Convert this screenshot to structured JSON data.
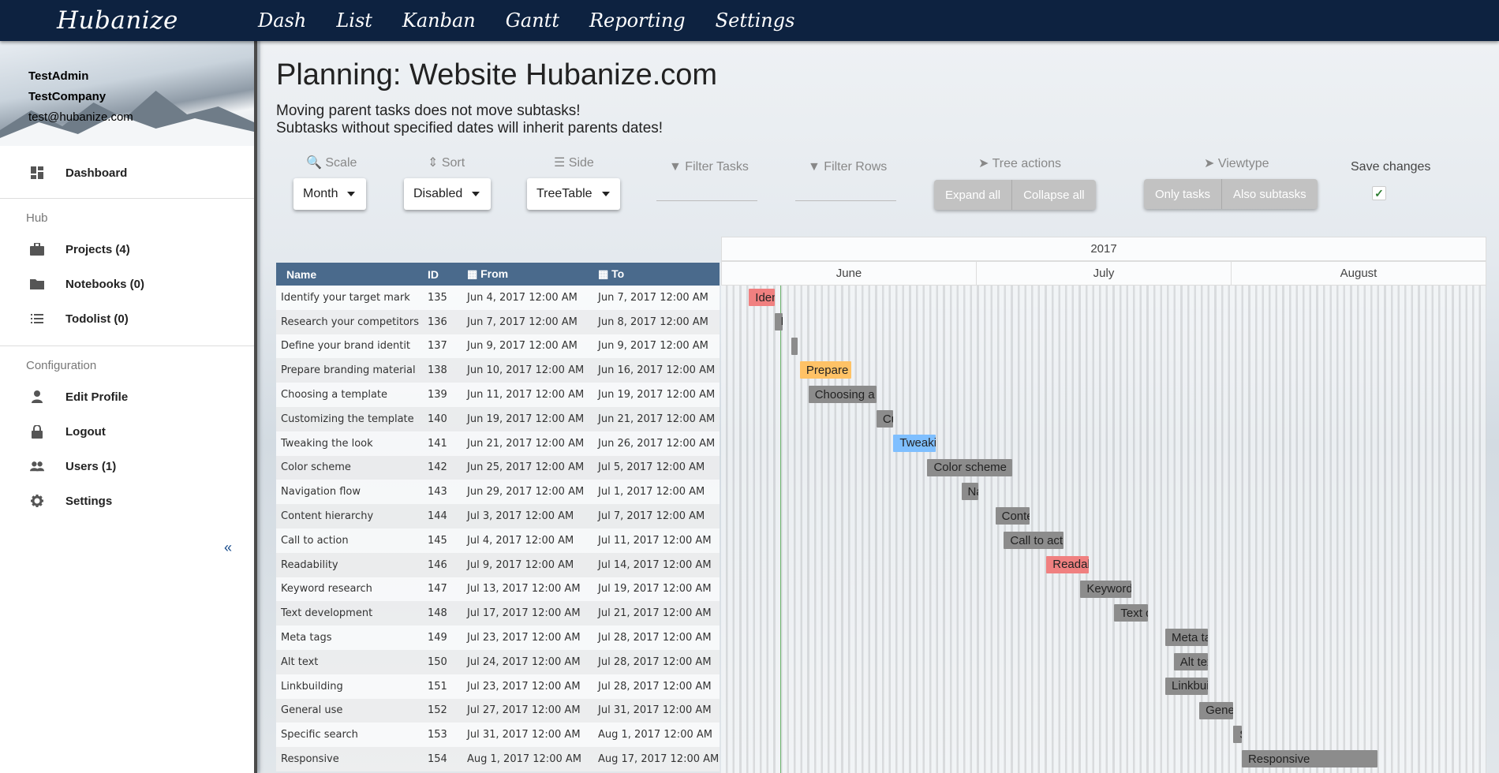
{
  "nav": {
    "brand": "Hubanize",
    "items": [
      "Dash",
      "List",
      "Kanban",
      "Gantt",
      "Reporting",
      "Settings"
    ]
  },
  "sidebar": {
    "user": {
      "name": "TestAdmin",
      "company": "TestCompany",
      "email": "test@hubanize.com"
    },
    "dashboard": {
      "label": "Dashboard",
      "icon": "dashboard-icon"
    },
    "hub_title": "Hub",
    "hub_items": [
      {
        "label": "Projects (4)",
        "icon": "briefcase-icon"
      },
      {
        "label": "Notebooks (0)",
        "icon": "folder-icon"
      },
      {
        "label": "Todolist (0)",
        "icon": "list-icon"
      }
    ],
    "config_title": "Configuration",
    "config_items": [
      {
        "label": "Edit Profile",
        "icon": "person-icon"
      },
      {
        "label": "Logout",
        "icon": "lock-icon"
      },
      {
        "label": "Users (1)",
        "icon": "people-icon"
      },
      {
        "label": "Settings",
        "icon": "gear-icon"
      }
    ],
    "collapse": "«"
  },
  "page": {
    "title": "Planning: Website Hubanize.com",
    "notice1": "Moving parent tasks does not move subtasks!",
    "notice2": "Subtasks without specified dates will inherit parents dates!"
  },
  "controls": {
    "scale": {
      "label": "Scale",
      "value": "Month"
    },
    "sort": {
      "label": "Sort",
      "value": "Disabled"
    },
    "side": {
      "label": "Side",
      "value": "TreeTable"
    },
    "filter_tasks": "Filter Tasks",
    "filter_rows": "Filter Rows",
    "tree_actions": {
      "label": "Tree actions",
      "expand": "Expand all",
      "collapse": "Collapse all"
    },
    "viewtype": {
      "label": "Viewtype",
      "only": "Only tasks",
      "also": "Also subtasks"
    },
    "save_changes": {
      "label": "Save changes",
      "checked": true
    }
  },
  "table": {
    "headers": {
      "name": "Name",
      "id": "ID",
      "from": "From",
      "to": "To"
    },
    "rows": [
      {
        "name": "Identify your target mark",
        "id": "135",
        "from": "Jun 4, 2017 12:00 AM",
        "to": "Jun 7, 2017 12:00 AM",
        "bar": "Identify your target mark",
        "color": "#f08080"
      },
      {
        "name": "Research your competitors",
        "id": "136",
        "from": "Jun 7, 2017 12:00 AM",
        "to": "Jun 8, 2017 12:00 AM",
        "bar": "Research your competitors",
        "color": "#8c8c8c"
      },
      {
        "name": "Define your brand identit",
        "id": "137",
        "from": "Jun 9, 2017 12:00 AM",
        "to": "Jun 9, 2017 12:00 AM",
        "bar": "Define your brand identity",
        "color": "#8c8c8c"
      },
      {
        "name": "Prepare branding material",
        "id": "138",
        "from": "Jun 10, 2017 12:00 AM",
        "to": "Jun 16, 2017 12:00 AM",
        "bar": "Prepare branding material",
        "color": "#ffc266"
      },
      {
        "name": "Choosing a template",
        "id": "139",
        "from": "Jun 11, 2017 12:00 AM",
        "to": "Jun 19, 2017 12:00 AM",
        "bar": "Choosing a template",
        "color": "#8c8c8c"
      },
      {
        "name": "Customizing the template",
        "id": "140",
        "from": "Jun 19, 2017 12:00 AM",
        "to": "Jun 21, 2017 12:00 AM",
        "bar": "Customizing the template",
        "color": "#8c8c8c"
      },
      {
        "name": "Tweaking the look",
        "id": "141",
        "from": "Jun 21, 2017 12:00 AM",
        "to": "Jun 26, 2017 12:00 AM",
        "bar": "Tweaking the look",
        "color": "#7fbfff"
      },
      {
        "name": "Color scheme",
        "id": "142",
        "from": "Jun 25, 2017 12:00 AM",
        "to": "Jul 5, 2017 12:00 AM",
        "bar": "Color scheme",
        "color": "#8c8c8c"
      },
      {
        "name": "Navigation flow",
        "id": "143",
        "from": "Jun 29, 2017 12:00 AM",
        "to": "Jul 1, 2017 12:00 AM",
        "bar": "Navigation flow",
        "color": "#8c8c8c"
      },
      {
        "name": "Content hierarchy",
        "id": "144",
        "from": "Jul 3, 2017 12:00 AM",
        "to": "Jul 7, 2017 12:00 AM",
        "bar": "Content hierarchy",
        "color": "#8c8c8c"
      },
      {
        "name": "Call to action",
        "id": "145",
        "from": "Jul 4, 2017 12:00 AM",
        "to": "Jul 11, 2017 12:00 AM",
        "bar": "Call to action",
        "color": "#8c8c8c"
      },
      {
        "name": "Readability",
        "id": "146",
        "from": "Jul 9, 2017 12:00 AM",
        "to": "Jul 14, 2017 12:00 AM",
        "bar": "Readability",
        "color": "#f08080"
      },
      {
        "name": "Keyword research",
        "id": "147",
        "from": "Jul 13, 2017 12:00 AM",
        "to": "Jul 19, 2017 12:00 AM",
        "bar": "Keyword research",
        "color": "#8c8c8c"
      },
      {
        "name": "Text development",
        "id": "148",
        "from": "Jul 17, 2017 12:00 AM",
        "to": "Jul 21, 2017 12:00 AM",
        "bar": "Text development",
        "color": "#8c8c8c"
      },
      {
        "name": "Meta tags",
        "id": "149",
        "from": "Jul 23, 2017 12:00 AM",
        "to": "Jul 28, 2017 12:00 AM",
        "bar": "Meta tags",
        "color": "#8c8c8c"
      },
      {
        "name": "Alt text",
        "id": "150",
        "from": "Jul 24, 2017 12:00 AM",
        "to": "Jul 28, 2017 12:00 AM",
        "bar": "Alt text",
        "color": "#8c8c8c"
      },
      {
        "name": "Linkbuilding",
        "id": "151",
        "from": "Jul 23, 2017 12:00 AM",
        "to": "Jul 28, 2017 12:00 AM",
        "bar": "Linkbuilding",
        "color": "#8c8c8c"
      },
      {
        "name": "General use",
        "id": "152",
        "from": "Jul 27, 2017 12:00 AM",
        "to": "Jul 31, 2017 12:00 AM",
        "bar": "General use",
        "color": "#8c8c8c"
      },
      {
        "name": "Specific search",
        "id": "153",
        "from": "Jul 31, 2017 12:00 AM",
        "to": "Aug 1, 2017 12:00 AM",
        "bar": "Specific search",
        "color": "#8c8c8c"
      },
      {
        "name": "Responsive",
        "id": "154",
        "from": "Aug 1, 2017 12:00 AM",
        "to": "Aug 17, 2017 12:00 AM",
        "bar": "Responsive",
        "color": "#8c8c8c"
      }
    ]
  },
  "gantt": {
    "year": "2017",
    "months": [
      "June",
      "July",
      "August"
    ],
    "today": "Jun 8, 2017"
  }
}
